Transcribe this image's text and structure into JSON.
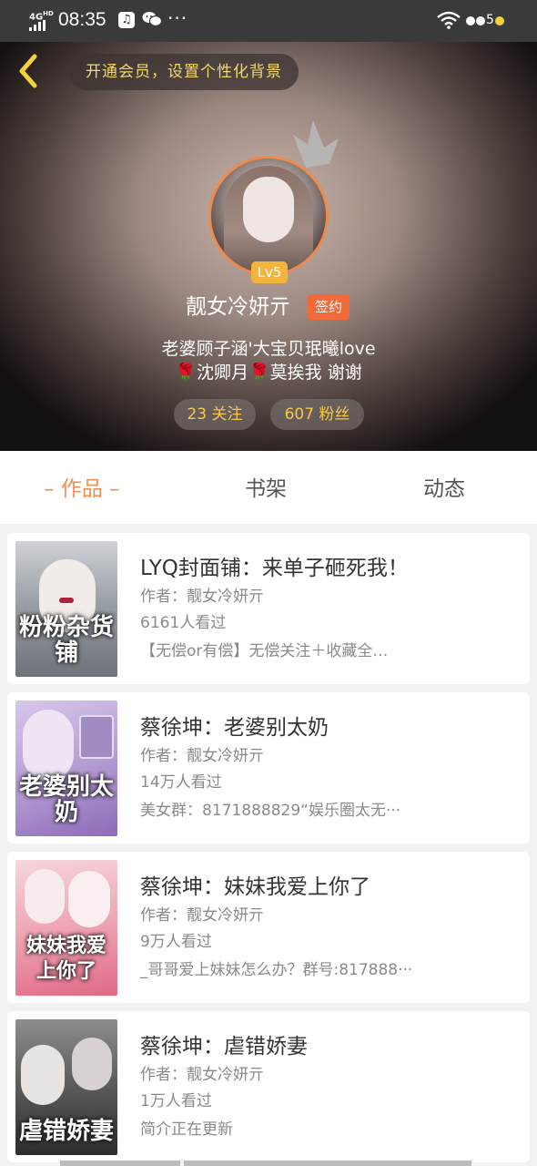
{
  "status_bar": {
    "network": "4G",
    "network_sup": "HD",
    "time": "08:35",
    "music_icon": "music-icon",
    "more": "···",
    "battery_label": "5"
  },
  "header": {
    "promo": "开通会员，设置个性化背景",
    "level": "Lv5",
    "username": "靓女冷妍亓",
    "signed_badge": "签约",
    "bio_line1": "老婆顾子涵'大宝贝珉曦love",
    "bio_line2_parts": [
      "🌹",
      "沈卿月",
      "🌹",
      "莫挨我 谢谢"
    ],
    "follow_count": "23",
    "follow_label": "关注",
    "fans_count": "607",
    "fans_label": "粉丝"
  },
  "tabs": [
    {
      "label": "作品",
      "active": true
    },
    {
      "label": "书架",
      "active": false
    },
    {
      "label": "动态",
      "active": false
    }
  ],
  "books": [
    {
      "title": "LYQ封面铺：来单子砸死我！",
      "author": "作者：靓女冷妍亓",
      "views": "6161人看过",
      "desc": "【无偿or有偿】无偿关注＋收藏全…",
      "cover_text": "粉粉杂货铺",
      "cover_colors": [
        "#cfd2d6",
        "#6e7279"
      ]
    },
    {
      "title": "蔡徐坤：老婆别太奶",
      "author": "作者：靓女冷妍亓",
      "views": "14万人看过",
      "desc": "美女群：8171888829“娱乐圈太无···",
      "cover_text": "老婆别太奶",
      "cover_colors": [
        "#d8c6ea",
        "#8c6bb8"
      ]
    },
    {
      "title": "蔡徐坤：妹妹我爱上你了",
      "author": "作者：靓女冷妍亓",
      "views": "9万人看过",
      "desc": "_哥哥爱上妹妹怎么办？群号:817888···",
      "cover_text": "妹妹我爱上你了",
      "cover_colors": [
        "#f7d6dc",
        "#e06a86"
      ]
    },
    {
      "title": "蔡徐坤：虐错娇妻",
      "author": "作者：靓女冷妍亓",
      "views": "1万人看过",
      "desc": "简介正在更新",
      "cover_text": "虐错娇妻",
      "cover_colors": [
        "#8d8d8d",
        "#2d2d2d"
      ]
    }
  ]
}
